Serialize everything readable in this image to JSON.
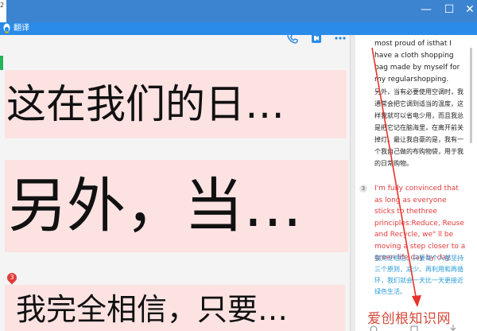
{
  "outer_window": {
    "left_stub_text": "2",
    "controls": {
      "minimize": "—",
      "maximize": "☐",
      "close": "✕"
    }
  },
  "translate_window": {
    "title": "翻译"
  },
  "left_panel": {
    "lines": [
      {
        "text": "这在我们的日…"
      },
      {
        "text": "另外，当…"
      },
      {
        "text": "我完全相信，只要…"
      }
    ],
    "marker": "3"
  },
  "right_panel": {
    "block1_en": "most proud of isthat I have a cloth shopping bag made by myself for my regularshopping.",
    "block1_zh": "另外，当有必要使用空调时，我通常会把它调到适当的温度，这样我就可以省电少用，而且我总是把它记在脑海里，在离开前关掉灯。最让我自豪的是，我有一个我自己做的布购物袋，用于我的日常购物。",
    "block3_num": "3",
    "block3_en": "I'm fully convinced that as long as everyone sticks to thethree principles:Reduce, Reuse and Recycle, we\" ll be moving a step closer to a green life day by day.",
    "block3_zh": "我完全相信，只要每个人都坚持三个原则，减少、再利用和再循环，我们就会一天比一天更接近绿色生活。"
  },
  "watermark": {
    "text": "爱创根知识网"
  },
  "colors": {
    "outer_bar": "#3c83d0",
    "title_bar": "#2a8be8",
    "highlight": "#fde2e2",
    "red": "#e33b3b",
    "blue_text": "#2a9bd8",
    "green_strip": "#25b25b"
  }
}
